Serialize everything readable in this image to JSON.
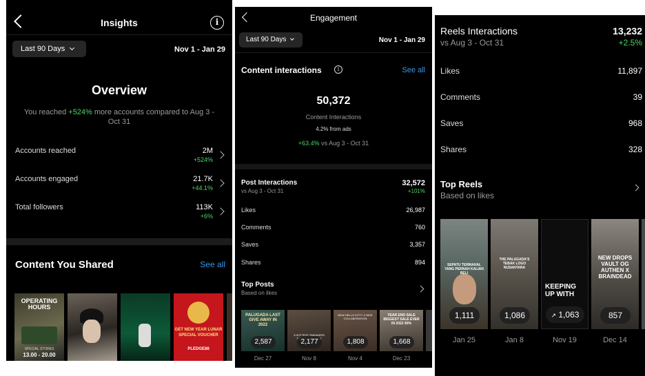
{
  "panel1": {
    "title": "Insights",
    "range_label": "Last 90 Days",
    "date_range": "Nov 1 - Jan 29",
    "overview_title": "Overview",
    "reach_prefix": "You reached ",
    "reach_pct": "+524%",
    "reach_suffix": " more accounts compared to Aug 3 - Oct 31",
    "rows": [
      {
        "label": "Accounts reached",
        "value": "2M",
        "delta": "+524%"
      },
      {
        "label": "Accounts engaged",
        "value": "21.7K",
        "delta": "+44.1%"
      },
      {
        "label": "Total followers",
        "value": "113K",
        "delta": "+6%"
      }
    ],
    "content_title": "Content You Shared",
    "see_all": "See all",
    "thumbs": [
      {
        "line1": "OPERATING",
        "line2": "HOURS",
        "line3": "13.00 - 20.00",
        "small": "SPECIAL STORES"
      },
      {
        "line1": "",
        "line2": "",
        "line3": "",
        "small": ""
      },
      {
        "line1": "",
        "line2": "",
        "line3": "",
        "small": ""
      },
      {
        "line1": "GET NEW YEAR LUNAR",
        "line2": "SPECIAL VOUCHER",
        "line3": "PLEDGE88",
        "small": ""
      }
    ]
  },
  "panel2": {
    "title": "Engagement",
    "range_label": "Last 90 Days",
    "date_range": "Nov 1 - Jan 29",
    "section_title": "Content interactions",
    "see_all": "See all",
    "big_value": "50,372",
    "big_caption": "Content Interactions",
    "ads_note": "4.2% from ads",
    "growth_pct": "+63.4%",
    "growth_suffix": " vs Aug 3 - Oct 31",
    "post_title": "Post Interactions",
    "post_value": "32,572",
    "post_sub": "vs Aug 3 - Oct 31",
    "post_delta": "+101%",
    "rows": [
      {
        "label": "Likes",
        "value": "26,987"
      },
      {
        "label": "Comments",
        "value": "760"
      },
      {
        "label": "Saves",
        "value": "3,357"
      },
      {
        "label": "Shares",
        "value": "894"
      }
    ],
    "top_title": "Top Posts",
    "top_sub": "Based on likes",
    "posts": [
      {
        "count": "2,587",
        "date": "Dec 27",
        "text": "PALUGADA LAST GIVE AWAY IN 2022"
      },
      {
        "count": "2,177",
        "date": "Nov 8",
        "text": "3 HOTTEST SNEAKERS TRENDS FOR 2023"
      },
      {
        "count": "1,808",
        "date": "Nov 4",
        "text": "NEW HELLO KITTY X NIKE COLLABORATION"
      },
      {
        "count": "1,668",
        "date": "Dec 23",
        "text": "YEAR END SALE BIGGEST SALE EVER IN 2022 90%"
      }
    ]
  },
  "panel3": {
    "reels_title": "Reels Interactions",
    "reels_value": "13,232",
    "reels_sub": "vs Aug 3 - Oct 31",
    "reels_delta": "+2.5%",
    "rows": [
      {
        "label": "Likes",
        "value": "11,897"
      },
      {
        "label": "Comments",
        "value": "39"
      },
      {
        "label": "Saves",
        "value": "968"
      },
      {
        "label": "Shares",
        "value": "328"
      }
    ],
    "top_title": "Top Reels",
    "top_sub": "Based on likes",
    "reels": [
      {
        "count": "1,111",
        "date": "Jan 25",
        "text": "SEPATU TERMAHAL YANG PERNAH KALIAN BELI"
      },
      {
        "count": "1,086",
        "date": "Jan 8",
        "text": "THE PALUGADA'S TEBAK LOGO NUSANTARA"
      },
      {
        "count": "1,063",
        "date": "Nov 19",
        "text": "KEEPING UP WITH"
      },
      {
        "count": "857",
        "date": "Dec 14",
        "text": "NEW DROPS VAULT OG AUTHEN X BRAINDEAD"
      }
    ]
  },
  "colors": {
    "accent_blue": "#3897f0",
    "positive_green": "#4cd864",
    "background": "#000000"
  }
}
